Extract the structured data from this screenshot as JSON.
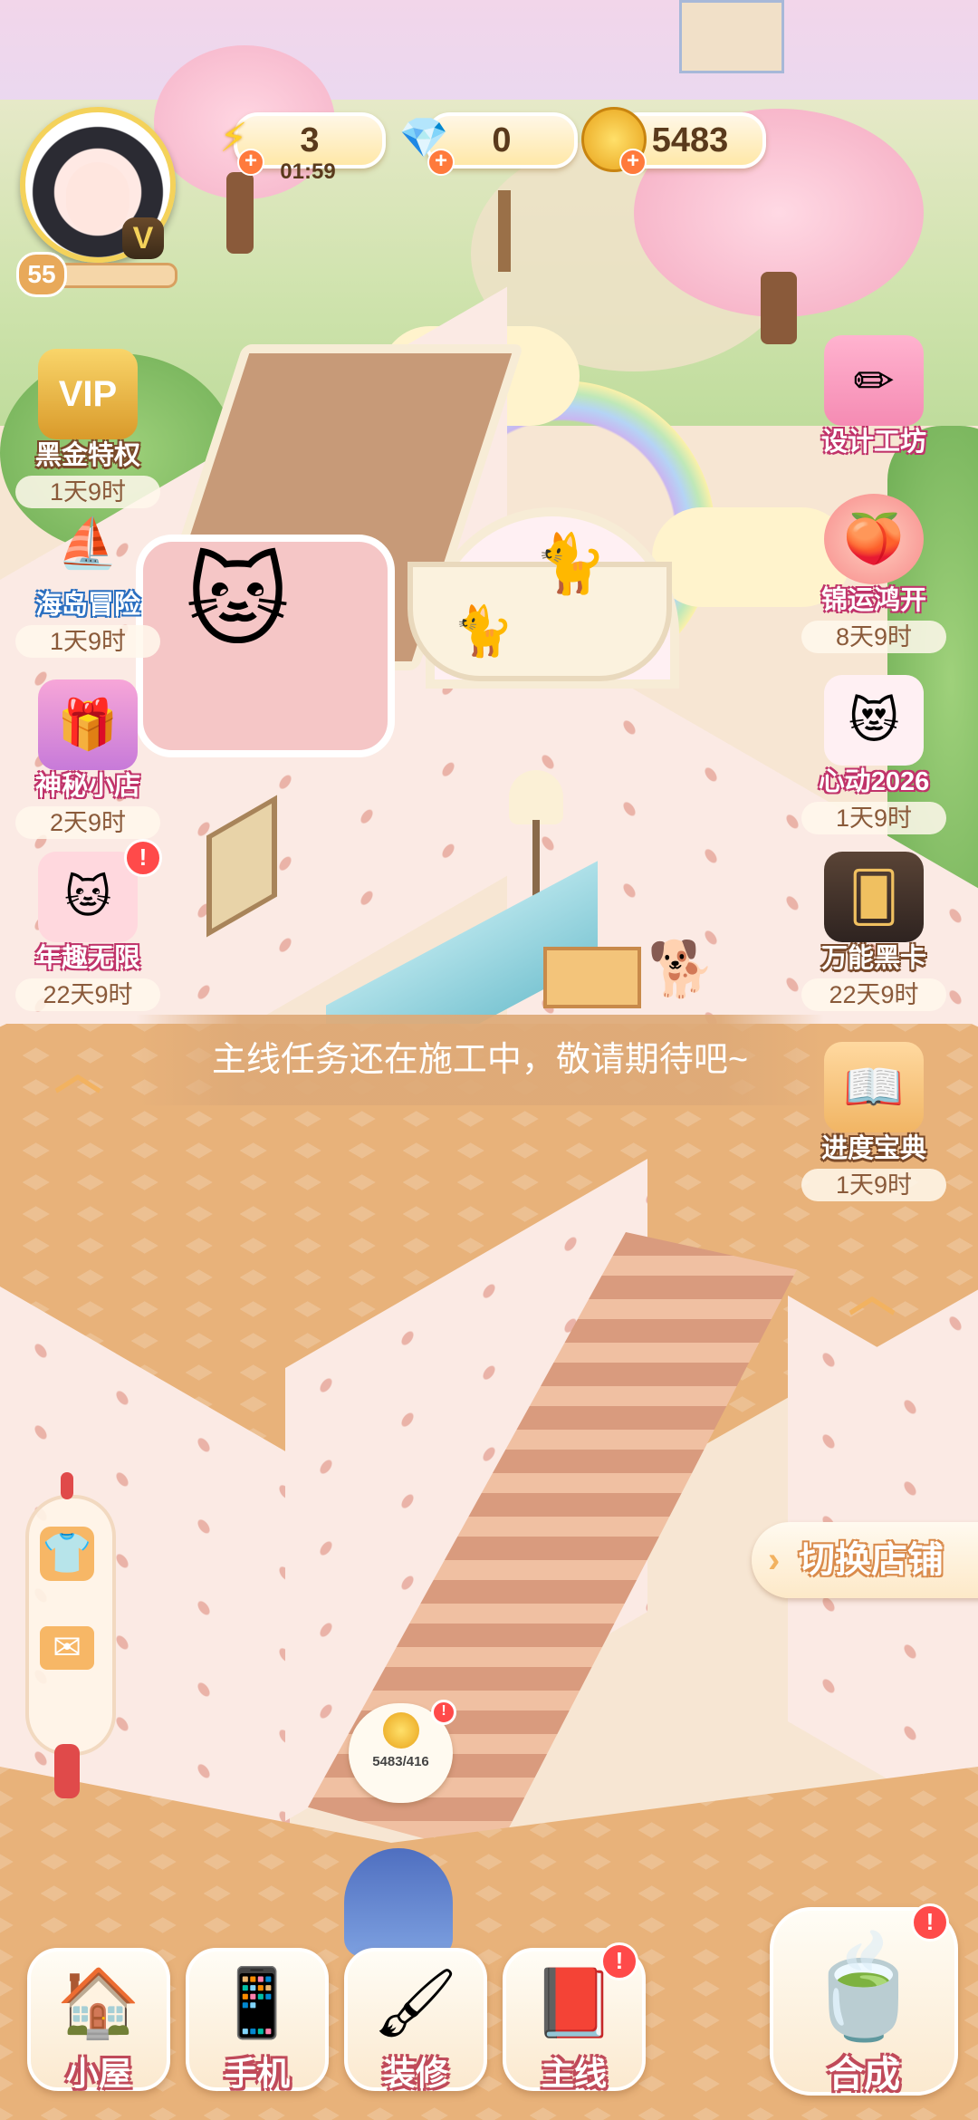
{
  "player": {
    "level": "55",
    "vip_mark": "V"
  },
  "resources": {
    "energy": {
      "value": "3",
      "timer": "01:59",
      "icon": "lightning-icon"
    },
    "gems": {
      "value": "0",
      "icon": "diamond-icon"
    },
    "coins": {
      "value": "5483",
      "icon": "coin-icon"
    }
  },
  "left_events": [
    {
      "label": "黑金特权",
      "timer": "1天9时",
      "icon": "vip-chest-icon"
    },
    {
      "label": "海岛冒险",
      "timer": "1天9时",
      "icon": "boat-icon"
    },
    {
      "label": "神秘小店",
      "timer": "2天9时",
      "icon": "gift-box-icon"
    },
    {
      "label": "年趣无限",
      "timer": "22天9时",
      "icon": "cat-card-icon"
    }
  ],
  "right_events": [
    {
      "label": "设计工坊",
      "timer": "",
      "icon": "ruler-pencil-icon"
    },
    {
      "label": "锦运鸿开",
      "timer": "8天9时",
      "icon": "peach-icon"
    },
    {
      "label": "心动2026",
      "timer": "1天9时",
      "icon": "cat-glasses-icon"
    },
    {
      "label": "万能黑卡",
      "timer": "22天9时",
      "icon": "cards-icon"
    },
    {
      "label": "进度宝典",
      "timer": "1天9时",
      "icon": "book-icon"
    }
  ],
  "toast": "主线任务还在施工中，敬请期待吧~",
  "switch_shop": "切换店铺",
  "coin_bubble": "5483/416",
  "bottom_nav": [
    {
      "label": "小屋",
      "icon": "house-icon"
    },
    {
      "label": "手机",
      "icon": "phone-icon"
    },
    {
      "label": "装修",
      "icon": "brush-icon"
    },
    {
      "label": "主线",
      "icon": "quest-book-icon"
    }
  ],
  "merge_button": {
    "label": "合成",
    "icon": "teacup-icon"
  },
  "colors": {
    "accent": "#ff7a3c",
    "badge": "#ff4a4a",
    "wall": "#fbeae4",
    "floor": "#e8b27a"
  }
}
